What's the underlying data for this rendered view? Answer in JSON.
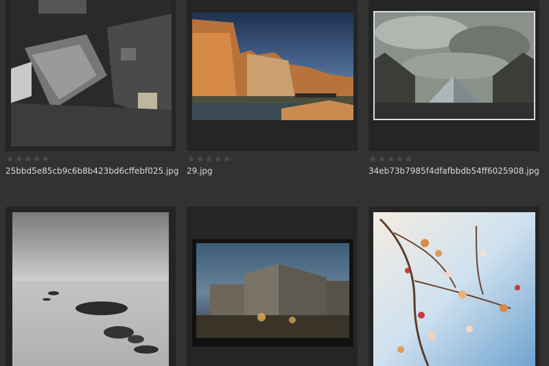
{
  "grid": {
    "items": [
      {
        "filename": "25bbd5e85cb9c6b8b423bd6cffebf025.jpg",
        "rating": 0,
        "stars": [
          "★",
          "★",
          "★",
          "★",
          "★"
        ],
        "subject": "dark tilted urban courtyard"
      },
      {
        "filename": "29.jpg",
        "rating": 0,
        "stars": [
          "★",
          "★",
          "★",
          "★",
          "★"
        ],
        "subject": "riverside buildings at sunset"
      },
      {
        "filename": "34eb73b7985f4dfafbbdb54ff6025908.jpg",
        "rating": 0,
        "stars": [
          "★",
          "★",
          "★",
          "★",
          "★"
        ],
        "subject": "glass pyramid under cloudy sky"
      },
      {
        "filename": "",
        "rating": 0,
        "stars": [],
        "subject": "misty sea with rocks"
      },
      {
        "filename": "",
        "rating": 0,
        "stars": [],
        "subject": "apartment block at dusk"
      },
      {
        "filename": "",
        "rating": 0,
        "stars": [],
        "subject": "blossom branch against blue sky"
      }
    ]
  },
  "colors": {
    "background": "#323232",
    "cell": "#252525",
    "star_empty": "#4a4a4a",
    "filename_text": "#d9d9d9"
  }
}
